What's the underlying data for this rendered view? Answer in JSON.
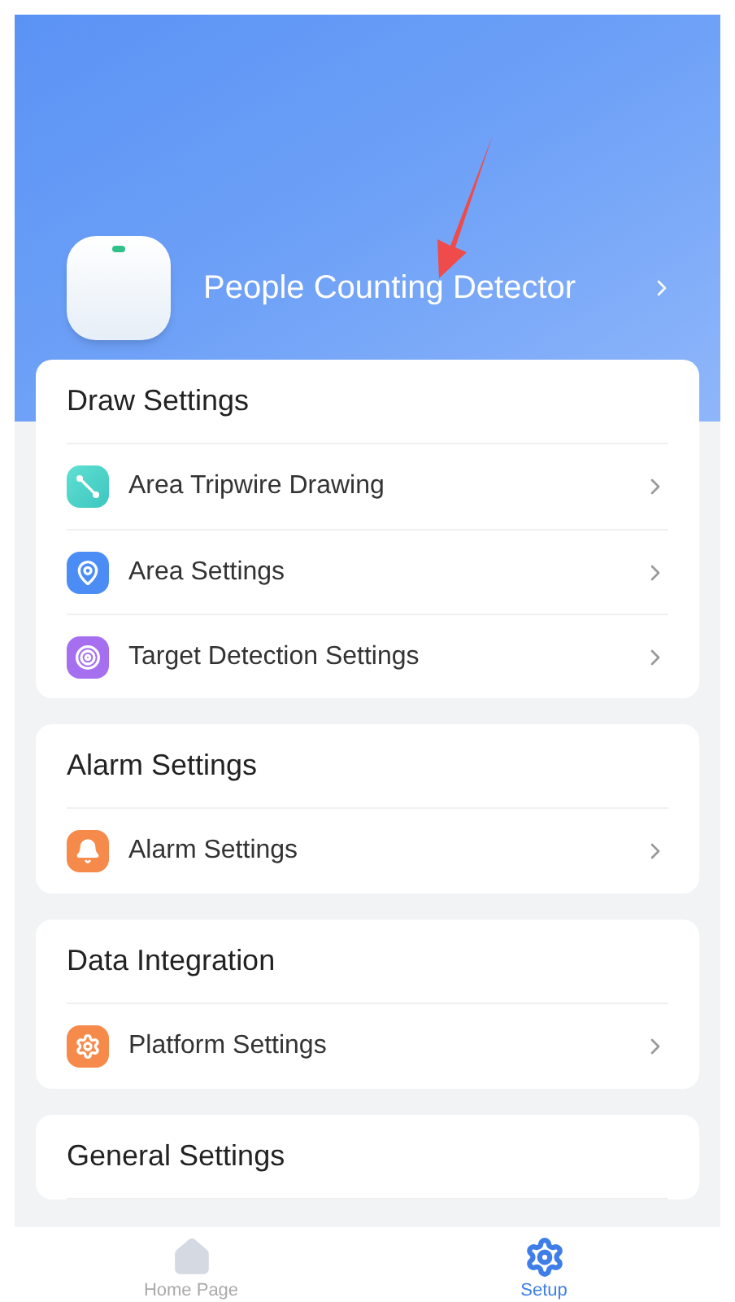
{
  "device": {
    "name": "People Counting Detector"
  },
  "sections": [
    {
      "title": "Draw Settings",
      "items": [
        {
          "label": "Area Tripwire Drawing",
          "kind": "tripwire"
        },
        {
          "label": "Area Settings",
          "kind": "location"
        },
        {
          "label": "Target Detection Settings",
          "kind": "target"
        }
      ]
    },
    {
      "title": "Alarm Settings",
      "items": [
        {
          "label": "Alarm Settings",
          "kind": "alarm"
        }
      ]
    },
    {
      "title": "Data Integration",
      "items": [
        {
          "label": "Platform Settings",
          "kind": "platform"
        }
      ]
    },
    {
      "title": "General Settings"
    }
  ],
  "nav": [
    {
      "label": "Home Page",
      "kind": "home",
      "selected": false
    },
    {
      "label": "Setup",
      "kind": "setup",
      "selected": true
    }
  ]
}
